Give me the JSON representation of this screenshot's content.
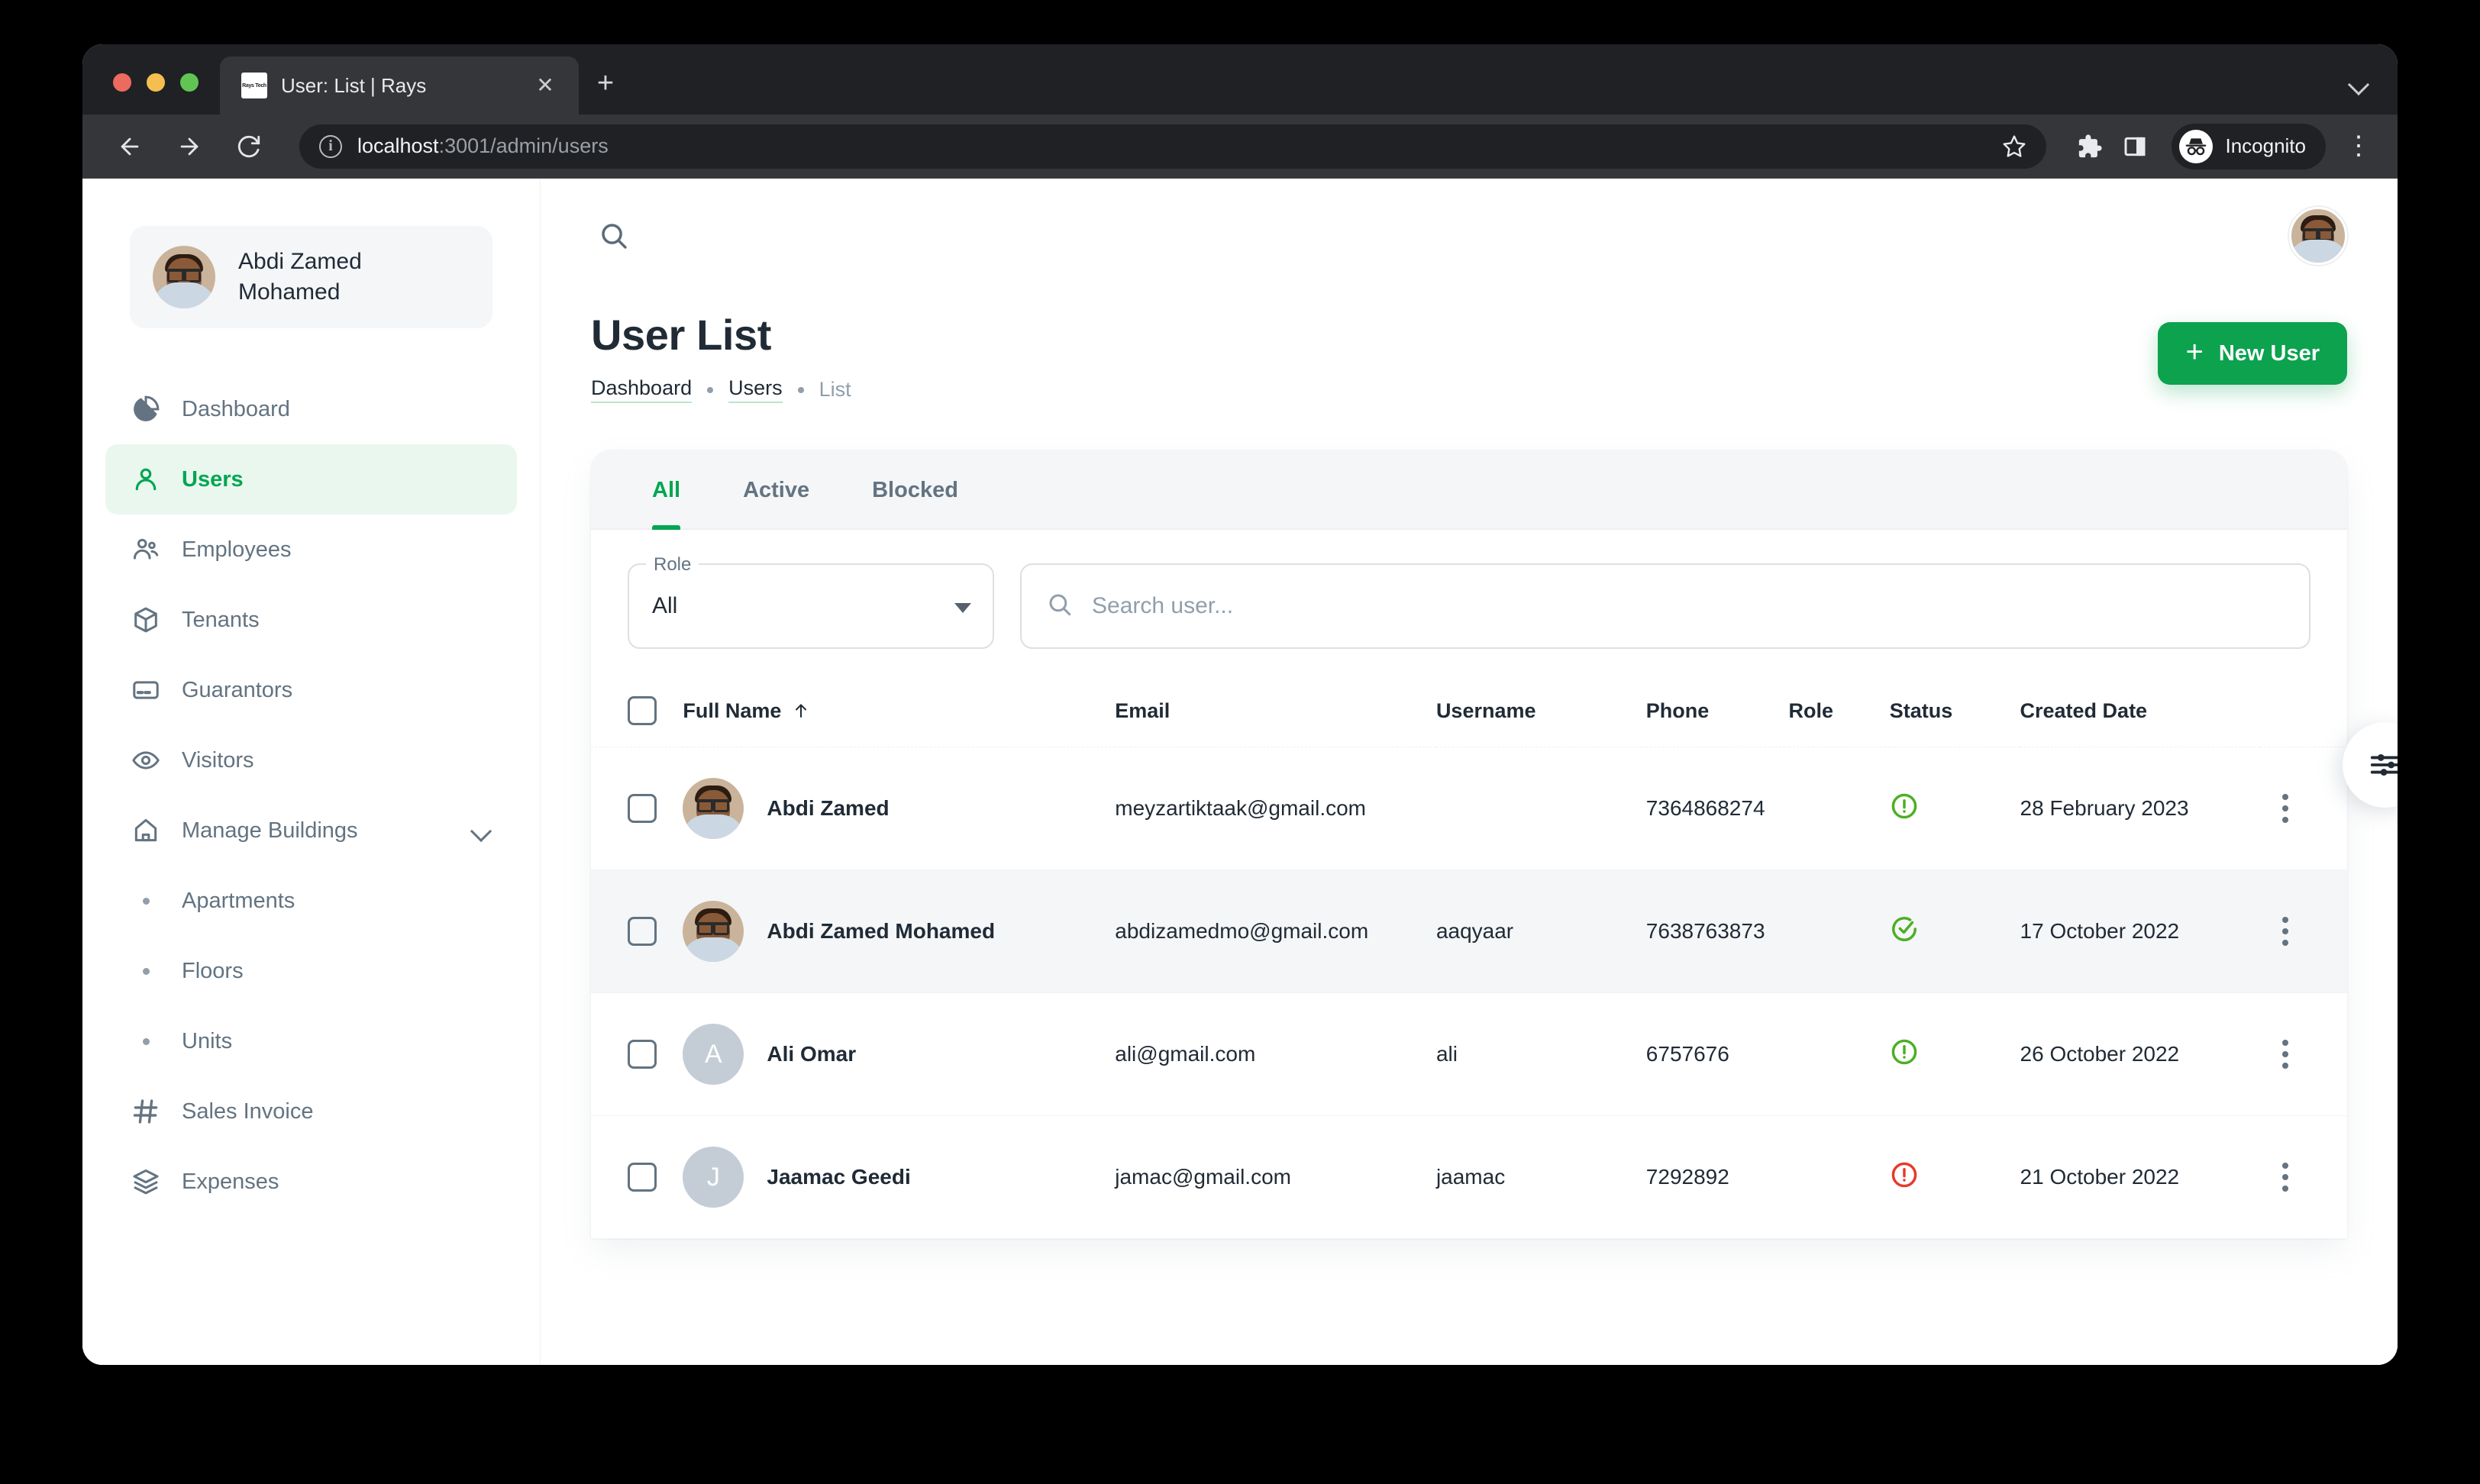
{
  "browser": {
    "tab": {
      "title": "User: List | Rays",
      "favicon_text": "Rays Tech",
      "close_label": "✕"
    },
    "new_tab_label": "+",
    "url": {
      "domain": "localhost",
      "path": ":3001/admin/users"
    },
    "profile_label": "Incognito",
    "icons": {
      "back": "back-arrow-icon",
      "forward": "forward-arrow-icon",
      "reload": "reload-icon",
      "site_info": "info-icon",
      "bookmark": "star-icon",
      "extensions": "puzzle-icon",
      "side_panel": "side-panel-icon",
      "menu": "kebab-menu-icon",
      "tab_list": "chevron-down-icon"
    }
  },
  "sidebar": {
    "profile": {
      "name_line1": "Abdi Zamed",
      "name_line2": "Mohamed"
    },
    "items": [
      {
        "label": "Dashboard",
        "icon": "pie-chart-icon",
        "active": false,
        "type": "item"
      },
      {
        "label": "Users",
        "icon": "person-icon",
        "active": true,
        "type": "item"
      },
      {
        "label": "Employees",
        "icon": "people-icon",
        "active": false,
        "type": "item"
      },
      {
        "label": "Tenants",
        "icon": "cube-icon",
        "active": false,
        "type": "item"
      },
      {
        "label": "Guarantors",
        "icon": "credit-card-icon",
        "active": false,
        "type": "item"
      },
      {
        "label": "Visitors",
        "icon": "eye-icon",
        "active": false,
        "type": "item"
      },
      {
        "label": "Manage Buildings",
        "icon": "home-icon",
        "active": false,
        "type": "group"
      },
      {
        "label": "Apartments",
        "icon": "bullet-icon",
        "active": false,
        "type": "sub"
      },
      {
        "label": "Floors",
        "icon": "bullet-icon",
        "active": false,
        "type": "sub"
      },
      {
        "label": "Units",
        "icon": "bullet-icon",
        "active": false,
        "type": "sub"
      },
      {
        "label": "Sales Invoice",
        "icon": "hash-icon",
        "active": false,
        "type": "item"
      },
      {
        "label": "Expenses",
        "icon": "layers-icon",
        "active": false,
        "type": "item"
      }
    ]
  },
  "header": {
    "title": "User List",
    "breadcrumb": [
      {
        "label": "Dashboard",
        "current": false
      },
      {
        "label": "Users",
        "current": false
      },
      {
        "label": "List",
        "current": true
      }
    ],
    "new_user_button": "New User",
    "plus_icon": "plus-icon",
    "search_icon": "search-icon",
    "avatar_icon": "avatar"
  },
  "tabs": [
    {
      "label": "All",
      "active": true
    },
    {
      "label": "Active",
      "active": false
    },
    {
      "label": "Blocked",
      "active": false
    }
  ],
  "filters": {
    "role_label": "Role",
    "role_value": "All",
    "search_placeholder": "Search user..."
  },
  "table": {
    "columns": [
      {
        "key": "check",
        "label": ""
      },
      {
        "key": "name",
        "label": "Full Name",
        "sorted": "asc"
      },
      {
        "key": "email",
        "label": "Email"
      },
      {
        "key": "username",
        "label": "Username"
      },
      {
        "key": "phone",
        "label": "Phone"
      },
      {
        "key": "role",
        "label": "Role"
      },
      {
        "key": "status",
        "label": "Status"
      },
      {
        "key": "date",
        "label": "Created Date"
      },
      {
        "key": "actions",
        "label": ""
      }
    ],
    "rows": [
      {
        "name": "Abdi Zamed",
        "email": "meyzartiktaak@gmail.com",
        "username": "",
        "phone": "7364868274",
        "role": "",
        "status": "alert",
        "status_color": "#4CAF22",
        "date": "28 February 2023",
        "avatar_type": "photo",
        "avatar_initial": "",
        "hover": false
      },
      {
        "name": "Abdi Zamed Mohamed",
        "email": "abdizamedmo@gmail.com",
        "username": "aaqyaar",
        "phone": "7638763873",
        "role": "",
        "status": "check",
        "status_color": "#4CAF22",
        "date": "17 October 2022",
        "avatar_type": "photo",
        "avatar_initial": "",
        "hover": true
      },
      {
        "name": "Ali Omar",
        "email": "ali@gmail.com",
        "username": "ali",
        "phone": "6757676",
        "role": "",
        "status": "alert",
        "status_color": "#4CAF22",
        "date": "26 October 2022",
        "avatar_type": "letter",
        "avatar_initial": "A",
        "hover": false
      },
      {
        "name": "Jaamac Geedi",
        "email": "jamac@gmail.com",
        "username": "jaamac",
        "phone": "7292892",
        "role": "",
        "status": "alert",
        "status_color": "#E8392B",
        "date": "21 October 2022",
        "avatar_type": "letter",
        "avatar_initial": "J",
        "hover": false
      }
    ]
  },
  "settings_tab": {
    "icon": "sliders-icon"
  },
  "colors": {
    "accent": "#00A651",
    "button": "#0CA24E",
    "danger": "#E8392B",
    "muted": "#637381",
    "text": "#212B36"
  }
}
